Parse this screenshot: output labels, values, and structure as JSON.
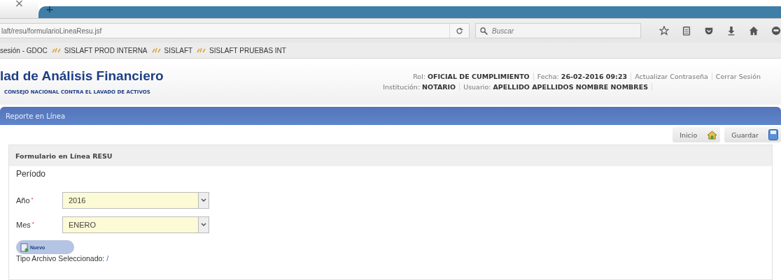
{
  "browser": {
    "tab_close": "×",
    "new_tab": "+",
    "url": "laft/resu/formularioLineaResu.jsf",
    "search_placeholder": "Buscar",
    "bookmarks": [
      {
        "label": "sesión - GDOC",
        "icon": false
      },
      {
        "label": "SISLAFT PROD INTERNA",
        "icon": true
      },
      {
        "label": "SISLAFT",
        "icon": true
      },
      {
        "label": "SISLAFT PRUEBAS INT",
        "icon": true
      }
    ]
  },
  "header": {
    "title": "lad de Análisis Financiero",
    "subtitle": "CONSEJO NACIONAL CONTRA EL LAVADO DE ACTIVOS",
    "line_1": [
      {
        "label": "Rol:",
        "value": "OFICIAL DE CUMPLIMIENTO"
      },
      {
        "label": "Fecha:",
        "value": "26-02-2016 09:23"
      }
    ],
    "links": [
      "Actualizar Contraseña",
      "Cerrar Sesión"
    ],
    "line_2": [
      {
        "label": "Institución:",
        "value": "NOTARIO"
      },
      {
        "label": "Usuario:",
        "value": "APELLIDO APELLIDOS NOMBRE NOMBRES"
      }
    ]
  },
  "section_bar": {
    "title": "Reporte en Línea"
  },
  "toolbar": [
    {
      "label": "Inicio",
      "kind": "home"
    },
    {
      "label": "Guardar",
      "kind": "save"
    }
  ],
  "form": {
    "title": "Formulario en Línea RESU",
    "section": "Período",
    "fields": [
      {
        "label": "Año",
        "required_mark": "*",
        "value": "2016"
      },
      {
        "label": "Mes",
        "required_mark": "*",
        "value": "ENERO"
      }
    ],
    "new_button": "Nuevo",
    "file_type_label": "Tipo Archivo Seleccionado:",
    "file_type_value": "/"
  }
}
